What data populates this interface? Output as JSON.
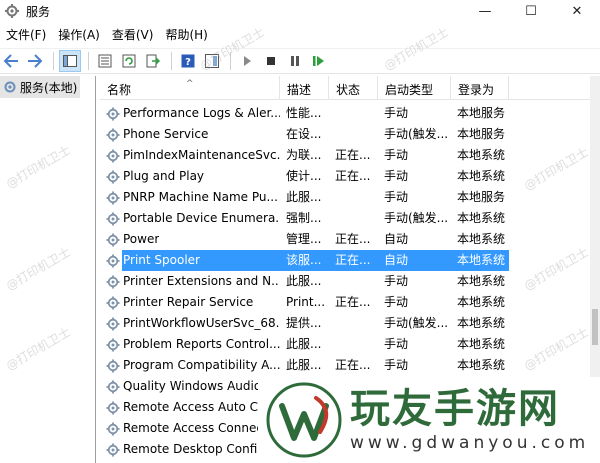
{
  "window": {
    "title": "服务",
    "minimize": "—",
    "maximize": "☐",
    "close": "✕"
  },
  "menu": [
    "文件(F)",
    "操作(A)",
    "查看(V)",
    "帮助(H)"
  ],
  "tree": {
    "label": "服务(本地)"
  },
  "columns": [
    "名称",
    "描述",
    "状态",
    "启动类型",
    "登录为"
  ],
  "services": [
    {
      "name": "Performance Logs & Aler...",
      "desc": "性能...",
      "status": "",
      "start": "手动",
      "login": "本地服务"
    },
    {
      "name": "Phone Service",
      "desc": "在设...",
      "status": "",
      "start": "手动(触发...",
      "login": "本地服务"
    },
    {
      "name": "PimIndexMaintenanceSvc...",
      "desc": "为联...",
      "status": "正在...",
      "start": "手动",
      "login": "本地系统"
    },
    {
      "name": "Plug and Play",
      "desc": "使计...",
      "status": "正在...",
      "start": "手动",
      "login": "本地系统"
    },
    {
      "name": "PNRP Machine Name Pu...",
      "desc": "此服...",
      "status": "",
      "start": "手动",
      "login": "本地服务"
    },
    {
      "name": "Portable Device Enumera...",
      "desc": "强制...",
      "status": "",
      "start": "手动(触发...",
      "login": "本地系统"
    },
    {
      "name": "Power",
      "desc": "管理...",
      "status": "正在...",
      "start": "自动",
      "login": "本地系统"
    },
    {
      "name": "Print Spooler",
      "desc": "该服...",
      "status": "正在...",
      "start": "自动",
      "login": "本地系统",
      "selected": true
    },
    {
      "name": "Printer Extensions and N...",
      "desc": "此服...",
      "status": "",
      "start": "手动",
      "login": "本地系统"
    },
    {
      "name": "Printer Repair Service",
      "desc": "Print...",
      "status": "正在...",
      "start": "手动",
      "login": "本地系统"
    },
    {
      "name": "PrintWorkflowUserSvc_68...",
      "desc": "提供...",
      "status": "",
      "start": "手动(触发...",
      "login": "本地系统"
    },
    {
      "name": "Problem Reports Control...",
      "desc": "此服...",
      "status": "",
      "start": "手动",
      "login": "本地系统"
    },
    {
      "name": "Program Compatibility A...",
      "desc": "此服...",
      "status": "正在...",
      "start": "手动",
      "login": "本地系统"
    },
    {
      "name": "Quality Windows Audio",
      "desc": "",
      "status": "",
      "start": "",
      "login": ""
    },
    {
      "name": "Remote Access Auto C",
      "desc": "",
      "status": "",
      "start": "",
      "login": ""
    },
    {
      "name": "Remote Access Connec",
      "desc": "",
      "status": "",
      "start": "",
      "login": ""
    },
    {
      "name": "Remote Desktop Confi",
      "desc": "",
      "status": "",
      "start": "",
      "login": ""
    }
  ],
  "watermark": "@打印机卫士",
  "logo": {
    "main": "玩友手游网",
    "url": "www.gdwanyou.com"
  },
  "colors": {
    "selection": "#3399ff",
    "logo_green": "#2f6b3a",
    "logo_red": "#c0392b"
  }
}
